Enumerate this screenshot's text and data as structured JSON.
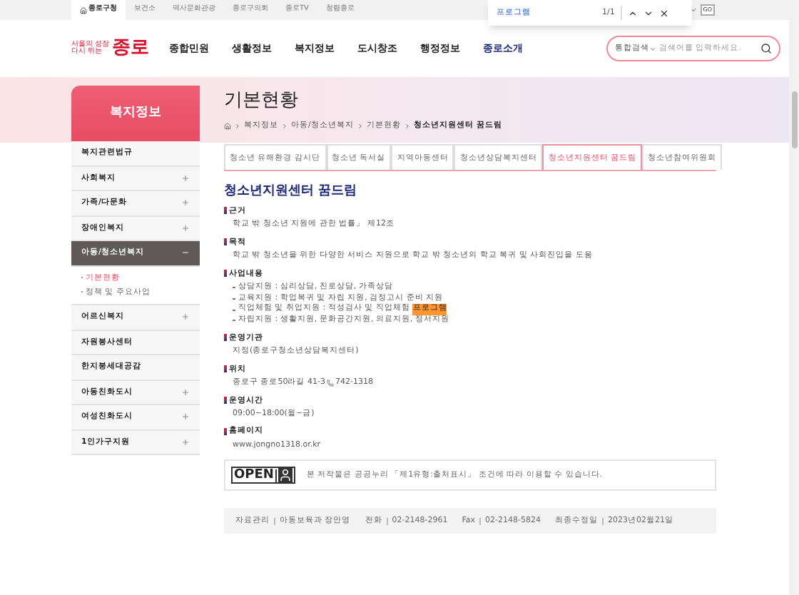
{
  "top_bar": {
    "links": [
      {
        "label": "종로구청",
        "selected": true
      },
      {
        "label": "보건소",
        "selected": false
      },
      {
        "label": "역사문화관광",
        "selected": false
      },
      {
        "label": "종로구의회",
        "selected": false
      },
      {
        "label": "종로TV",
        "selected": false
      },
      {
        "label": "청렴종로",
        "selected": false
      }
    ],
    "go_button": "GO"
  },
  "find_bar": {
    "query": "프로그램",
    "count": "1/1"
  },
  "header": {
    "logo": {
      "line1": "서울의 성장",
      "line2": "다시 뛰는",
      "name": "종로"
    },
    "nav": [
      {
        "label": "종합민원",
        "selected": false
      },
      {
        "label": "생활정보",
        "selected": false
      },
      {
        "label": "복지정보",
        "selected": false
      },
      {
        "label": "도시창조",
        "selected": false
      },
      {
        "label": "행정정보",
        "selected": false
      },
      {
        "label": "종로소개",
        "selected": true
      }
    ],
    "search": {
      "scope": "통합검색",
      "placeholder": "검색어를 입력하세요."
    }
  },
  "sidebar": {
    "title": "복지정보",
    "items": [
      {
        "label": "복지관련법규",
        "expandable": false,
        "expanded": false,
        "selected": false
      },
      {
        "label": "사회복지",
        "expandable": true,
        "expanded": false,
        "selected": false
      },
      {
        "label": "가족/다문화",
        "expandable": true,
        "expanded": false,
        "selected": false
      },
      {
        "label": "장애인복지",
        "expandable": true,
        "expanded": false,
        "selected": false
      },
      {
        "label": "아동/청소년복지",
        "expandable": true,
        "expanded": true,
        "selected": true,
        "children": [
          {
            "label": "기본현황",
            "selected": true
          },
          {
            "label": "정책 및 주요사업",
            "selected": false
          }
        ]
      },
      {
        "label": "어르신복지",
        "expandable": true,
        "expanded": false,
        "selected": false
      },
      {
        "label": "자원봉사센터",
        "expandable": false,
        "expanded": false,
        "selected": false
      },
      {
        "label": "한지붕세대공감",
        "expandable": false,
        "expanded": false,
        "selected": false
      },
      {
        "label": "아동친화도시",
        "expandable": true,
        "expanded": false,
        "selected": false
      },
      {
        "label": "여성친화도시",
        "expandable": true,
        "expanded": false,
        "selected": false
      },
      {
        "label": "1인가구지원",
        "expandable": true,
        "expanded": false,
        "selected": false
      }
    ]
  },
  "page": {
    "title": "기본현황",
    "breadcrumb": [
      "복지정보",
      "아동/청소년복지",
      "기본현황",
      "청소년지원센터 꿈드림"
    ],
    "tabs": [
      {
        "label": "청소년 유해환경 감시단",
        "selected": false
      },
      {
        "label": "청소년 독서실",
        "selected": false
      },
      {
        "label": "지역아동센터",
        "selected": false
      },
      {
        "label": "청소년상담복지센터",
        "selected": false
      },
      {
        "label": "청소년지원센터 꿈드림",
        "selected": true
      },
      {
        "label": "청소년참여위원회",
        "selected": false
      }
    ],
    "heading": "청소년지원센터 꿈드림",
    "sections": [
      {
        "title": "근거",
        "kind": "text",
        "text": "학교 밖 청소년 지원에 관한 법률」 제12조"
      },
      {
        "title": "목적",
        "kind": "text",
        "text": "학교 밖 청소년을 위한 다양한 서비스 지원으로 학교 밖 청소년의 학교 복귀 및 사회진입을 도움"
      },
      {
        "title": "사업내용",
        "kind": "list",
        "items": [
          {
            "text": "상담지원 : 심리상담, 진로상담, 가족상담"
          },
          {
            "text": "교육지원 : 학업복귀 및 자립 지원, 검정고시 준비 지원"
          },
          {
            "text": "직업체험 및 취업지원 : 적성검사 및 직업체험",
            "highlight": "프로그램"
          },
          {
            "text": "자립지원 : 생활지원, 문화공간지원, 의료지원, 정서지원"
          }
        ]
      },
      {
        "title": "운영기관",
        "kind": "text",
        "text": "지정(종로구청소년상담복지센터)"
      },
      {
        "title": "위치",
        "kind": "address",
        "text": "종로구 종로50라길 41-3",
        "phone": "742-1318"
      },
      {
        "title": "운영시간",
        "kind": "text",
        "text": "09:00~18:00(월~금)"
      },
      {
        "title": "홈페이지",
        "kind": "text",
        "text": "www.jongno1318.or.kr"
      }
    ]
  },
  "license": {
    "badge": "OPEN",
    "text": "본 저작물은 공공누리 「제1유형:출처표시」 조건에 따라 이용할 수 있습니다."
  },
  "footer": [
    {
      "label": "자료관리",
      "value": "아동보육과 장안영"
    },
    {
      "label": "전화",
      "value": "02-2148-2961"
    },
    {
      "label": "Fax",
      "value": "02-2148-5824"
    },
    {
      "label": "최종수정일",
      "value": "2023년02월21일"
    }
  ]
}
